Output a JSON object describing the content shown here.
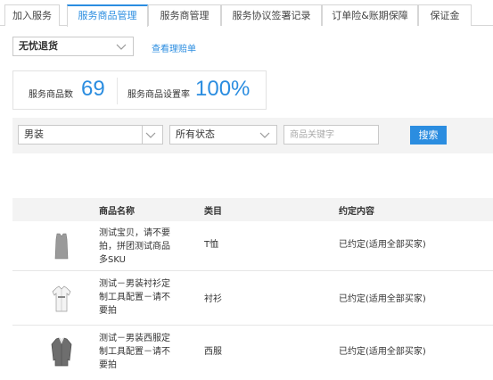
{
  "tabs": [
    {
      "label": "加入服务"
    },
    {
      "label": "服务商品管理"
    },
    {
      "label": "服务商管理"
    },
    {
      "label": "服务协议签署记录"
    },
    {
      "label": "订单险&账期保障"
    },
    {
      "label": "保证金"
    }
  ],
  "active_tab_index": 1,
  "service_select": {
    "value": "无忧退货"
  },
  "claims_link": "查看理赔单",
  "stats": {
    "count_label": "服务商品数",
    "count_value": "69",
    "rate_label": "服务商品设置率",
    "rate_value": "100%"
  },
  "filters": {
    "category": "男装",
    "status": "所有状态",
    "keyword_placeholder": "商品关键字",
    "search_label": "搜索"
  },
  "table": {
    "headers": [
      "商品名称",
      "类目",
      "约定内容"
    ],
    "rows": [
      {
        "name": "测试宝贝，请不要拍，拼团测试商品多SKU",
        "name_lines": [
          "测试宝贝，请不要",
          "拍，拼团测试商品",
          "多SKU"
        ],
        "category": "T恤",
        "agreement": "已约定(适用全部买家)",
        "thumb_icon": "vest-icon"
      },
      {
        "name": "测试－男装衬衫定制工具配置－请不要拍",
        "name_lines": [
          "测试－男装衬衫定",
          "制工具配置－请不",
          "要拍"
        ],
        "category": "衬衫",
        "agreement": "已约定(适用全部买家)",
        "thumb_icon": "shirt-icon"
      },
      {
        "name": "测试－男装西服定制工具配置－请不要拍",
        "name_lines": [
          "测试－男装西服定",
          "制工具配置－请不",
          "要拍"
        ],
        "category": "西服",
        "agreement": "已约定(适用全部买家)",
        "thumb_icon": "suit-icon"
      }
    ]
  },
  "colors": {
    "accent": "#2b8de0",
    "border": "#d6d6d6",
    "header_bg": "#f3f3f3"
  }
}
